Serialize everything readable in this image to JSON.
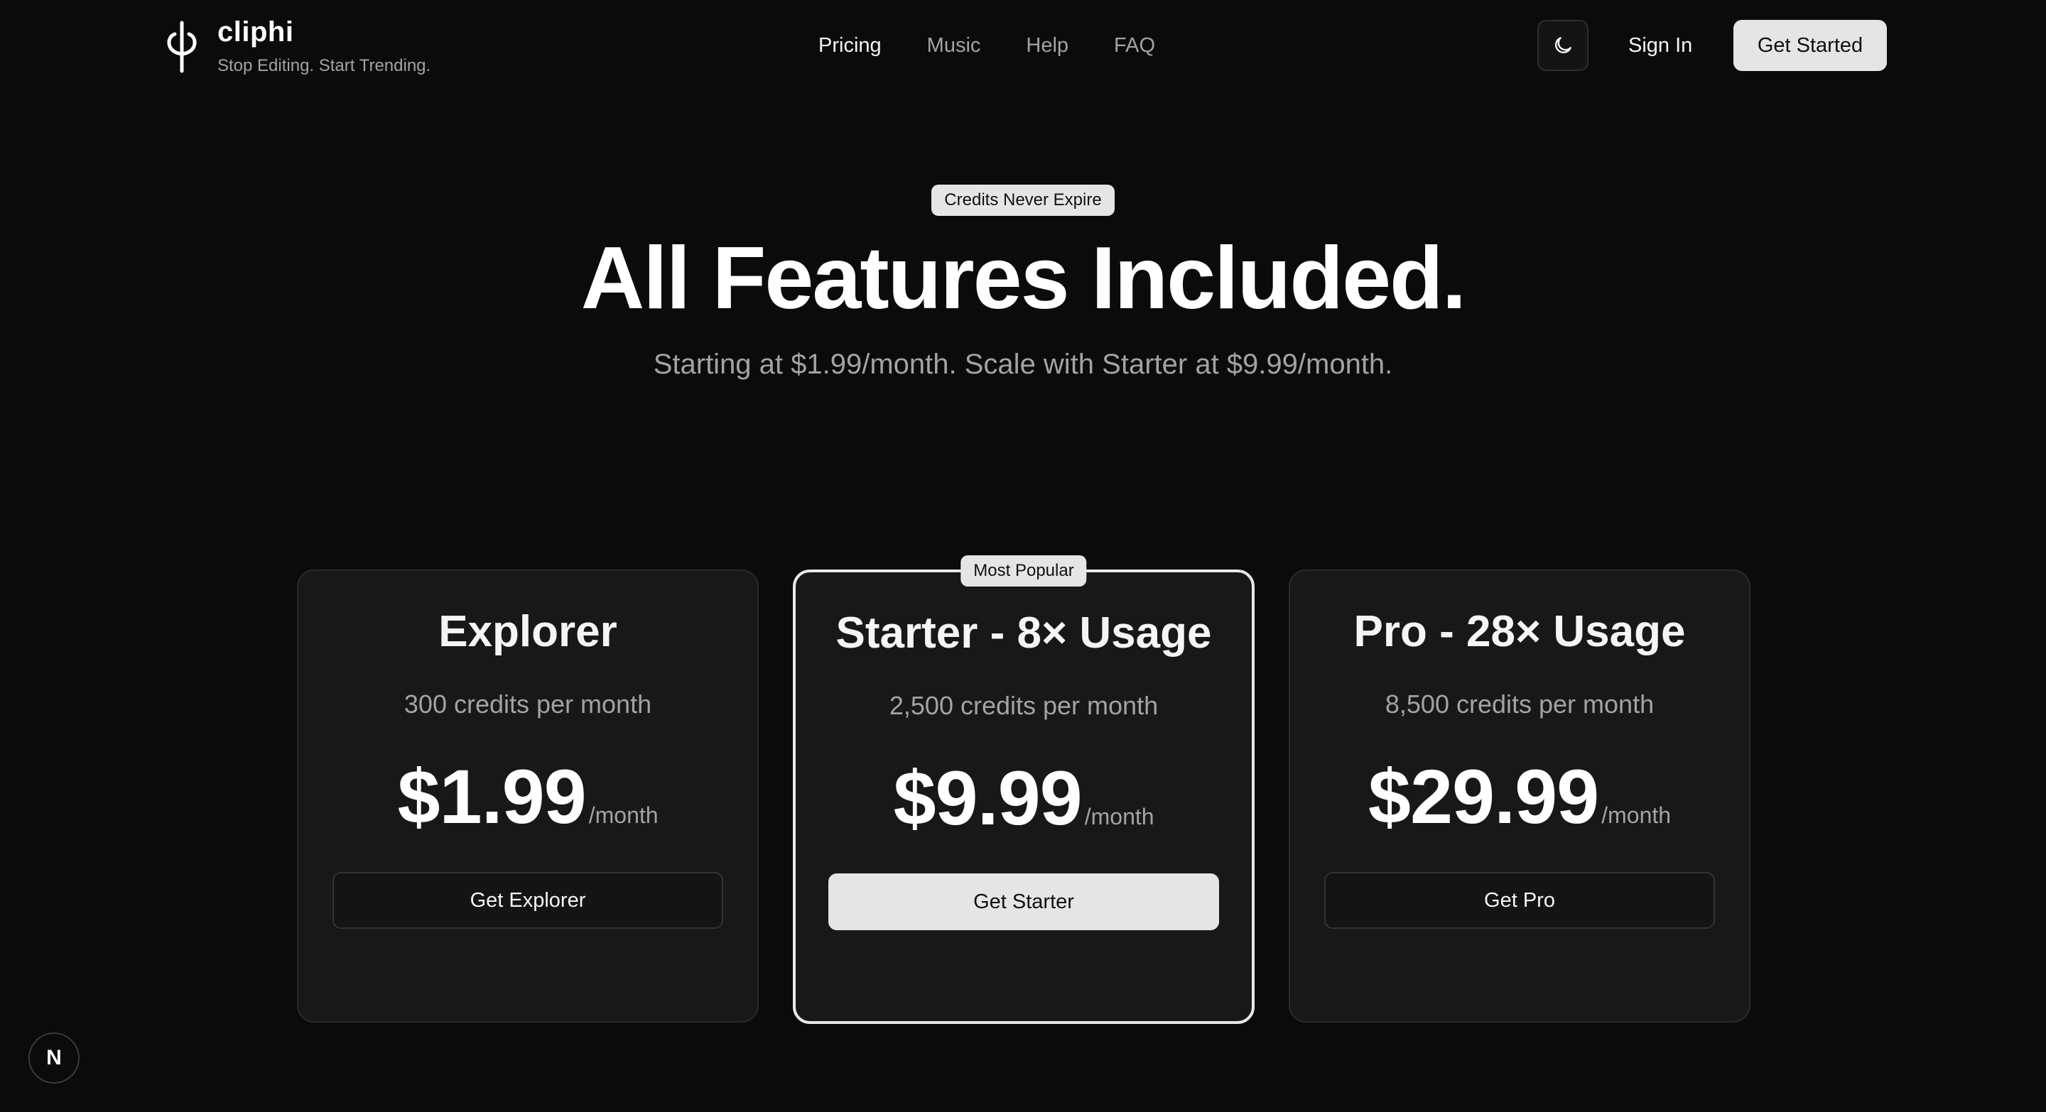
{
  "brand": {
    "name": "cliphi",
    "tagline": "Stop Editing. Start Trending."
  },
  "nav": {
    "items": [
      {
        "label": "Pricing",
        "active": true
      },
      {
        "label": "Music",
        "active": false
      },
      {
        "label": "Help",
        "active": false
      },
      {
        "label": "FAQ",
        "active": false
      }
    ],
    "theme_icon": "moon-icon",
    "signin_label": "Sign In",
    "get_started_label": "Get Started"
  },
  "hero": {
    "badge": "Credits Never Expire",
    "title": "All Features Included.",
    "subtitle": "Starting at $1.99/month. Scale with Starter at $9.99/month."
  },
  "plans": [
    {
      "title": "Explorer",
      "credits": "300 credits per month",
      "price": "$1.99",
      "period": "/month",
      "button": "Get Explorer",
      "featured": false
    },
    {
      "title": "Starter - 8× Usage",
      "credits": "2,500 credits per month",
      "price": "$9.99",
      "period": "/month",
      "button": "Get Starter",
      "featured": true,
      "badge": "Most Popular"
    },
    {
      "title": "Pro - 28× Usage",
      "credits": "8,500 credits per month",
      "price": "$29.99",
      "period": "/month",
      "button": "Get Pro",
      "featured": false
    }
  ],
  "dev_badge": {
    "label": "N"
  },
  "colors": {
    "background": "#0b0b0b",
    "card": "#181818",
    "accent_button": "#e5e5e5",
    "muted_text": "#a3a3a3"
  }
}
